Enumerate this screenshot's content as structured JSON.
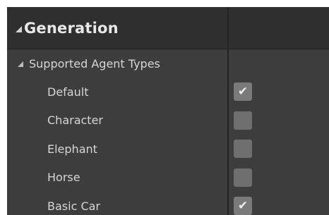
{
  "category": {
    "title": "Generation"
  },
  "group": {
    "label": "Supported Agent Types"
  },
  "agent_types": [
    {
      "label": "Default",
      "checked": true
    },
    {
      "label": "Character",
      "checked": false
    },
    {
      "label": "Elephant",
      "checked": false
    },
    {
      "label": "Horse",
      "checked": false
    },
    {
      "label": "Basic Car",
      "checked": true
    }
  ],
  "icons": {
    "expand": "triangle-expanded-icon",
    "check": "checkmark-icon"
  },
  "colors": {
    "panel_bg": "#3d3d3d",
    "category_bg": "#2f2f2f",
    "checkbox_bg": "#6f6f6f",
    "text": "#d6d6d6"
  }
}
